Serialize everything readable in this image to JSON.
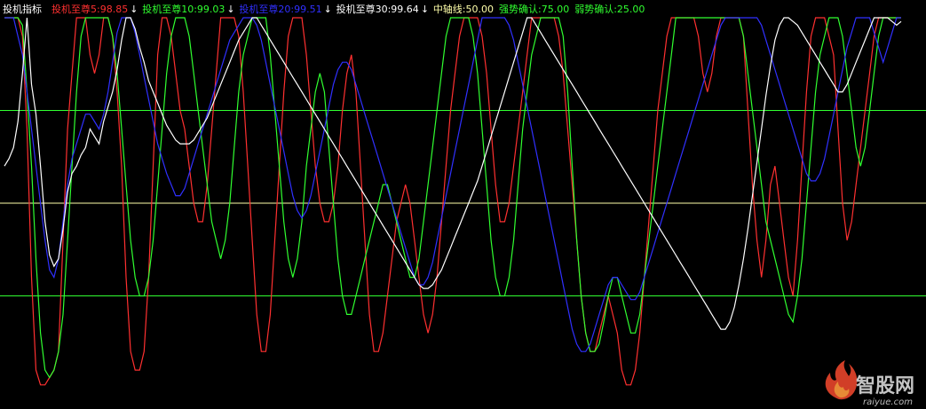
{
  "chart_data": {
    "type": "line",
    "title": "投机指标",
    "x": [
      0,
      1,
      2,
      3,
      4,
      5,
      6,
      7,
      8,
      9,
      10,
      11,
      12,
      13,
      14,
      15,
      16,
      17,
      18,
      19,
      20,
      21,
      22,
      23,
      24,
      25,
      26,
      27,
      28,
      29,
      30,
      31,
      32,
      33,
      34,
      35,
      36,
      37,
      38,
      39,
      40,
      41,
      42,
      43,
      44,
      45,
      46,
      47,
      48,
      49,
      50,
      51,
      52,
      53,
      54,
      55,
      56,
      57,
      58,
      59,
      60,
      61,
      62,
      63,
      64,
      65,
      66,
      67,
      68,
      69,
      70,
      71,
      72,
      73,
      74,
      75,
      76,
      77,
      78,
      79,
      80,
      81,
      82,
      83,
      84,
      85,
      86,
      87,
      88,
      89,
      90,
      91,
      92,
      93,
      94,
      95,
      96,
      97,
      98,
      99,
      100,
      101,
      102,
      103,
      104,
      105,
      106,
      107,
      108,
      109,
      110,
      111,
      112,
      113,
      114,
      115,
      116,
      117,
      118,
      119,
      120,
      121,
      122,
      123,
      124,
      125,
      126,
      127,
      128,
      129,
      130,
      131,
      132,
      133,
      134,
      135,
      136,
      137,
      138,
      139,
      140,
      141,
      142,
      143,
      144,
      145,
      146,
      147,
      148,
      149,
      150,
      151,
      152,
      153,
      154,
      155,
      156,
      157,
      158,
      159,
      160,
      161,
      162,
      163,
      164,
      165,
      166,
      167,
      168,
      169,
      170,
      171,
      172,
      173,
      174,
      175,
      176,
      177,
      178,
      179,
      180,
      181,
      182,
      183,
      184,
      185,
      186,
      187,
      188,
      189,
      190,
      191,
      192,
      193,
      194,
      195,
      196,
      197,
      198,
      199
    ],
    "ylim": [
      0,
      100
    ],
    "series": [
      {
        "name": "投机至尊5",
        "label_value": "98.85",
        "color": "#ff3030",
        "values": [
          100,
          100,
          100,
          100,
          95,
          70,
          30,
          5,
          1,
          1,
          3,
          5,
          10,
          40,
          70,
          85,
          100,
          100,
          100,
          90,
          85,
          90,
          100,
          100,
          95,
          80,
          60,
          30,
          10,
          5,
          5,
          10,
          30,
          60,
          90,
          100,
          100,
          95,
          85,
          75,
          70,
          60,
          50,
          45,
          45,
          55,
          70,
          85,
          100,
          100,
          100,
          100,
          95,
          80,
          60,
          40,
          20,
          10,
          10,
          20,
          40,
          60,
          80,
          95,
          100,
          100,
          100,
          90,
          75,
          60,
          50,
          45,
          45,
          50,
          60,
          75,
          85,
          90,
          80,
          60,
          40,
          20,
          10,
          10,
          15,
          25,
          35,
          45,
          50,
          55,
          50,
          40,
          30,
          20,
          15,
          20,
          30,
          45,
          60,
          75,
          85,
          95,
          100,
          100,
          100,
          100,
          95,
          85,
          70,
          55,
          45,
          45,
          50,
          60,
          70,
          80,
          90,
          100,
          100,
          100,
          100,
          100,
          100,
          95,
          85,
          70,
          55,
          40,
          25,
          15,
          10,
          10,
          15,
          20,
          25,
          20,
          15,
          5,
          1,
          1,
          5,
          15,
          30,
          45,
          60,
          75,
          85,
          95,
          100,
          100,
          100,
          100,
          100,
          100,
          95,
          85,
          80,
          85,
          95,
          100,
          100,
          100,
          100,
          100,
          95,
          75,
          55,
          40,
          30,
          40,
          55,
          60,
          50,
          40,
          30,
          25,
          40,
          60,
          80,
          95,
          100,
          100,
          100,
          95,
          90,
          70,
          50,
          40,
          45,
          55,
          65,
          75,
          85,
          95,
          100,
          100,
          100,
          100,
          100,
          100
        ]
      },
      {
        "name": "投机至尊10",
        "label_value": "99.03",
        "color": "#30ff30",
        "values": [
          100,
          100,
          100,
          100,
          98,
          80,
          60,
          35,
          15,
          5,
          3,
          5,
          10,
          20,
          40,
          60,
          80,
          95,
          100,
          100,
          100,
          100,
          100,
          100,
          95,
          85,
          70,
          55,
          40,
          30,
          25,
          25,
          30,
          40,
          55,
          70,
          85,
          95,
          100,
          100,
          100,
          95,
          85,
          75,
          65,
          55,
          45,
          40,
          35,
          40,
          50,
          65,
          80,
          90,
          95,
          100,
          100,
          100,
          100,
          90,
          75,
          60,
          45,
          35,
          30,
          35,
          45,
          60,
          70,
          80,
          85,
          80,
          65,
          50,
          35,
          25,
          20,
          20,
          25,
          30,
          35,
          40,
          45,
          50,
          55,
          55,
          50,
          45,
          40,
          35,
          30,
          30,
          35,
          45,
          55,
          65,
          75,
          85,
          95,
          100,
          100,
          100,
          100,
          100,
          95,
          85,
          70,
          55,
          40,
          30,
          25,
          25,
          30,
          40,
          55,
          70,
          80,
          90,
          95,
          100,
          100,
          100,
          100,
          100,
          95,
          80,
          60,
          40,
          25,
          15,
          10,
          10,
          12,
          18,
          25,
          30,
          30,
          25,
          20,
          15,
          15,
          20,
          30,
          40,
          50,
          60,
          70,
          80,
          90,
          100,
          100,
          100,
          100,
          100,
          100,
          100,
          100,
          100,
          100,
          100,
          100,
          100,
          100,
          100,
          95,
          85,
          75,
          65,
          55,
          45,
          40,
          35,
          30,
          25,
          20,
          18,
          25,
          35,
          50,
          65,
          80,
          90,
          95,
          100,
          100,
          100,
          95,
          85,
          75,
          65,
          60,
          65,
          75,
          85,
          95,
          100,
          100,
          100,
          100,
          100
        ]
      },
      {
        "name": "投机至尊20",
        "label_value": "99.51",
        "color": "#3030ff",
        "values": [
          100,
          100,
          100,
          95,
          90,
          80,
          70,
          60,
          50,
          40,
          32,
          30,
          35,
          45,
          55,
          62,
          66,
          70,
          74,
          74,
          72,
          70,
          74,
          80,
          88,
          96,
          100,
          100,
          100,
          96,
          90,
          84,
          78,
          72,
          66,
          62,
          58,
          55,
          52,
          52,
          54,
          58,
          62,
          66,
          70,
          74,
          78,
          82,
          86,
          90,
          94,
          96,
          98,
          100,
          100,
          100,
          98,
          94,
          88,
          82,
          76,
          70,
          64,
          58,
          52,
          48,
          46,
          48,
          52,
          58,
          64,
          70,
          76,
          82,
          86,
          88,
          88,
          86,
          82,
          78,
          74,
          70,
          66,
          62,
          58,
          54,
          50,
          46,
          42,
          38,
          34,
          30,
          28,
          28,
          30,
          34,
          40,
          46,
          52,
          58,
          64,
          70,
          76,
          82,
          88,
          94,
          100,
          100,
          100,
          100,
          100,
          100,
          98,
          94,
          88,
          82,
          76,
          70,
          64,
          58,
          52,
          46,
          40,
          34,
          28,
          22,
          16,
          12,
          10,
          10,
          12,
          16,
          20,
          24,
          28,
          30,
          30,
          28,
          26,
          24,
          24,
          26,
          30,
          34,
          38,
          42,
          46,
          50,
          54,
          58,
          62,
          66,
          70,
          74,
          78,
          82,
          86,
          90,
          94,
          98,
          100,
          100,
          100,
          100,
          100,
          100,
          100,
          100,
          98,
          94,
          90,
          86,
          82,
          78,
          74,
          70,
          66,
          62,
          58,
          56,
          56,
          58,
          62,
          68,
          74,
          80,
          86,
          92,
          96,
          100,
          100,
          100,
          100,
          96,
          92,
          88,
          92,
          96,
          100,
          100
        ]
      },
      {
        "name": "投机至尊30",
        "label_value": "99.64",
        "color": "#ffffff",
        "values": [
          60,
          62,
          65,
          72,
          85,
          100,
          82,
          74,
          60,
          45,
          36,
          33,
          35,
          43,
          53,
          58,
          60,
          63,
          65,
          70,
          68,
          66,
          72,
          76,
          80,
          86,
          94,
          100,
          100,
          97,
          92,
          88,
          83,
          80,
          77,
          74,
          71,
          69,
          67,
          66,
          66,
          66,
          67,
          69,
          71,
          73,
          76,
          79,
          82,
          85,
          88,
          91,
          94,
          96,
          98,
          100,
          100,
          98,
          96,
          94,
          92,
          90,
          88,
          86,
          84,
          82,
          80,
          78,
          76,
          74,
          72,
          70,
          68,
          66,
          64,
          62,
          60,
          58,
          56,
          54,
          52,
          50,
          48,
          46,
          44,
          42,
          40,
          38,
          36,
          34,
          32,
          30,
          28,
          27,
          27,
          28,
          30,
          32,
          35,
          38,
          41,
          44,
          47,
          50,
          53,
          56,
          60,
          64,
          68,
          72,
          76,
          80,
          84,
          88,
          92,
          96,
          100,
          100,
          98,
          96,
          94,
          92,
          90,
          88,
          86,
          84,
          82,
          80,
          78,
          76,
          74,
          72,
          70,
          68,
          66,
          64,
          62,
          60,
          58,
          56,
          54,
          52,
          50,
          48,
          46,
          44,
          42,
          40,
          38,
          36,
          34,
          32,
          30,
          28,
          26,
          24,
          22,
          20,
          18,
          16,
          16,
          18,
          22,
          28,
          35,
          43,
          52,
          61,
          70,
          79,
          87,
          94,
          98,
          100,
          100,
          99,
          98,
          96,
          94,
          92,
          90,
          88,
          86,
          84,
          82,
          80,
          80,
          82,
          85,
          88,
          91,
          94,
          97,
          100,
          100,
          100,
          100,
          99,
          98,
          99
        ]
      }
    ],
    "hlines": [
      {
        "name": "中轴线",
        "label_value": "50.00",
        "y": 50,
        "color": "#ffffaa"
      },
      {
        "name": "强势确认",
        "label_value": "75.00",
        "y": 75,
        "color": "#30ff30"
      },
      {
        "name": "弱势确认",
        "label_value": "25.00",
        "y": 25,
        "color": "#30ff30"
      }
    ],
    "header": {
      "indicator_name": "投机指标",
      "indicator_color": "#ffffff"
    }
  },
  "watermark": {
    "brand": "智股网",
    "domain": "raiyue.com"
  }
}
